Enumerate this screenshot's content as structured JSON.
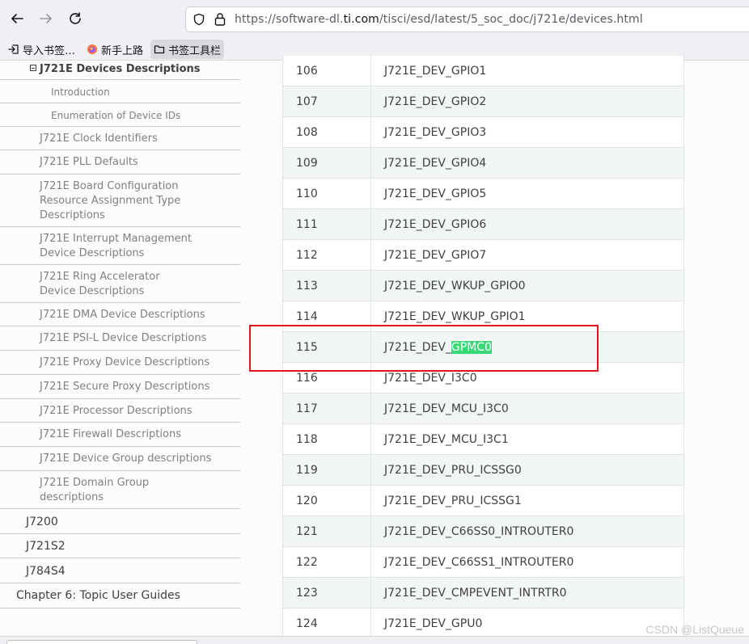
{
  "browser": {
    "url_prefix": "https://software-dl.",
    "url_host": "ti.com",
    "url_path": "/tisci/esd/latest/5_soc_doc/j721e/devices.html"
  },
  "bookmarks": [
    {
      "label": "导入书签…",
      "icon": "import-icon"
    },
    {
      "label": "新手上路",
      "icon": "firefox-icon"
    },
    {
      "label": "书签工具栏",
      "icon": "folder-icon"
    }
  ],
  "sidebar": {
    "current": "J721E Devices Descriptions",
    "items": [
      {
        "label": "Introduction"
      },
      {
        "label": "Enumeration of Device IDs"
      },
      {
        "label": "J721E Clock Identifiers"
      },
      {
        "label": "J721E PLL Defaults"
      },
      {
        "label": "J721E Board Configuration Resource Assignment Type Descriptions"
      },
      {
        "label": "J721E Interrupt Management Device Descriptions"
      },
      {
        "label": "J721E Ring Accelerator Device Descriptions"
      },
      {
        "label": "J721E DMA Device Descriptions"
      },
      {
        "label": "J721E PSI-L Device Descriptions"
      },
      {
        "label": "J721E Proxy Device Descriptions"
      },
      {
        "label": "J721E Secure Proxy Descriptions"
      },
      {
        "label": "J721E Processor Descriptions"
      },
      {
        "label": "J721E Firewall Descriptions"
      },
      {
        "label": "J721E Device Group descriptions"
      },
      {
        "label": "J721E Domain Group descriptions"
      },
      {
        "label": "J7200"
      },
      {
        "label": "J721S2"
      },
      {
        "label": "J784S4"
      },
      {
        "label": "Chapter 6: Topic User Guides"
      }
    ]
  },
  "table": {
    "rows": [
      {
        "id": "106",
        "name": "J721E_DEV_GPIO1"
      },
      {
        "id": "107",
        "name": "J721E_DEV_GPIO2"
      },
      {
        "id": "108",
        "name": "J721E_DEV_GPIO3"
      },
      {
        "id": "109",
        "name": "J721E_DEV_GPIO4"
      },
      {
        "id": "110",
        "name": "J721E_DEV_GPIO5"
      },
      {
        "id": "111",
        "name": "J721E_DEV_GPIO6"
      },
      {
        "id": "112",
        "name": "J721E_DEV_GPIO7"
      },
      {
        "id": "113",
        "name": "J721E_DEV_WKUP_GPIO0"
      },
      {
        "id": "114",
        "name": "J721E_DEV_WKUP_GPIO1"
      },
      {
        "id": "115",
        "name": "J721E_DEV_",
        "highlight": "GPMC0"
      },
      {
        "id": "116",
        "name": "J721E_DEV_I3C0"
      },
      {
        "id": "117",
        "name": "J721E_DEV_MCU_I3C0"
      },
      {
        "id": "118",
        "name": "J721E_DEV_MCU_I3C1"
      },
      {
        "id": "119",
        "name": "J721E_DEV_PRU_ICSSG0"
      },
      {
        "id": "120",
        "name": "J721E_DEV_PRU_ICSSG1"
      },
      {
        "id": "121",
        "name": "J721E_DEV_C66SS0_INTROUTER0"
      },
      {
        "id": "122",
        "name": "J721E_DEV_C66SS1_INTROUTER0"
      },
      {
        "id": "123",
        "name": "J721E_DEV_CMPEVENT_INTRTR0"
      },
      {
        "id": "124",
        "name": "J721E_DEV_GPU0"
      }
    ]
  },
  "watermark": "CSDN @ListQueue",
  "colors": {
    "search_highlight": "#38d878",
    "annotation_box": "#e3141d"
  }
}
